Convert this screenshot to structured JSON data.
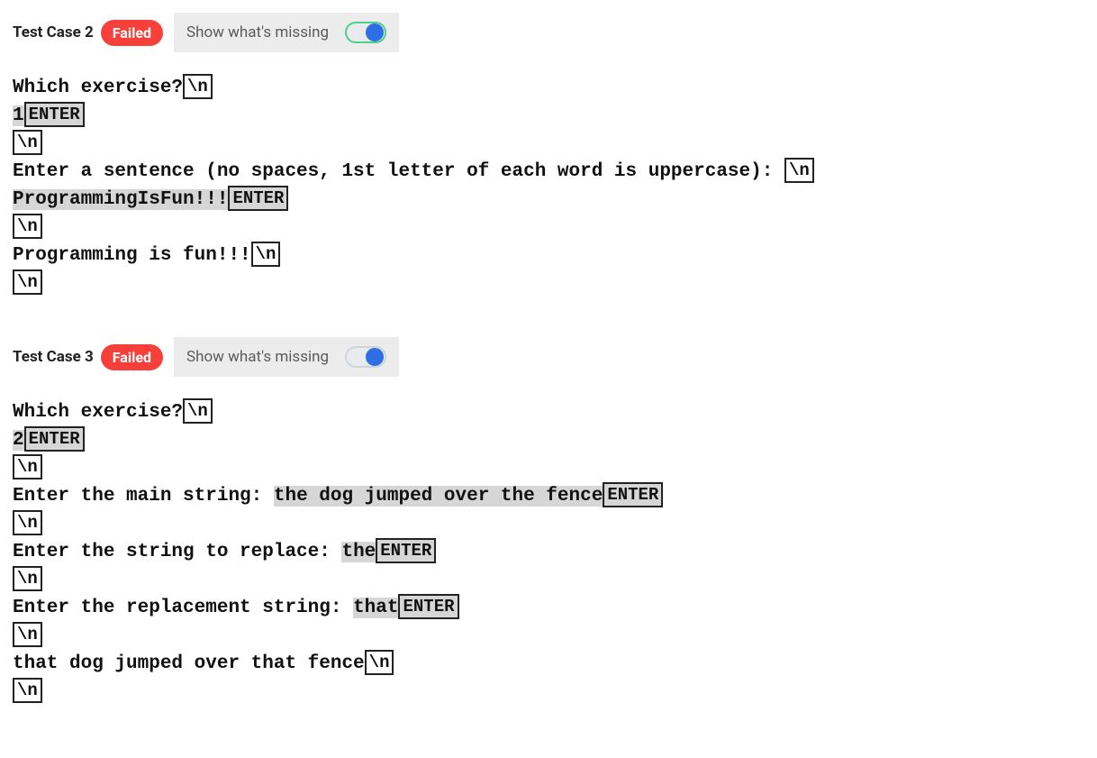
{
  "tokens": {
    "nl": "\\n",
    "enter": "ENTER"
  },
  "toggle": {
    "label": "Show what's missing"
  },
  "tests": [
    {
      "title": "Test Case 2",
      "status": "Failed",
      "toggle_variant": "green",
      "lines": [
        [
          {
            "t": "text",
            "v": "Which exercise?"
          },
          {
            "t": "nl"
          }
        ],
        [
          {
            "t": "text",
            "v": "1",
            "hl": true
          },
          {
            "t": "enter",
            "hl": true
          }
        ],
        [
          {
            "t": "nl"
          }
        ],
        [
          {
            "t": "text",
            "v": "Enter a sentence (no spaces, 1st letter of each word is uppercase): "
          },
          {
            "t": "nl"
          }
        ],
        [
          {
            "t": "text",
            "v": "ProgrammingIsFun!!!",
            "hl": true
          },
          {
            "t": "enter",
            "hl": true
          }
        ],
        [
          {
            "t": "nl"
          }
        ],
        [
          {
            "t": "text",
            "v": "Programming is fun!!!"
          },
          {
            "t": "nl"
          }
        ],
        [
          {
            "t": "nl"
          }
        ]
      ]
    },
    {
      "title": "Test Case 3",
      "status": "Failed",
      "toggle_variant": "plain",
      "lines": [
        [
          {
            "t": "text",
            "v": "Which exercise?"
          },
          {
            "t": "nl"
          }
        ],
        [
          {
            "t": "text",
            "v": "2",
            "hl": true
          },
          {
            "t": "enter",
            "hl": true
          }
        ],
        [
          {
            "t": "nl"
          }
        ],
        [
          {
            "t": "text",
            "v": "Enter the main string: "
          },
          {
            "t": "text",
            "v": "the dog jumped over the fence",
            "hl": true
          },
          {
            "t": "enter",
            "hl": true
          }
        ],
        [
          {
            "t": "nl"
          }
        ],
        [
          {
            "t": "text",
            "v": "Enter the string to replace: "
          },
          {
            "t": "text",
            "v": "the",
            "hl": true
          },
          {
            "t": "enter",
            "hl": true
          }
        ],
        [
          {
            "t": "nl"
          }
        ],
        [
          {
            "t": "text",
            "v": "Enter the replacement string: "
          },
          {
            "t": "text",
            "v": "that",
            "hl": true
          },
          {
            "t": "enter",
            "hl": true
          }
        ],
        [
          {
            "t": "nl"
          }
        ],
        [
          {
            "t": "text",
            "v": "that dog jumped over that fence"
          },
          {
            "t": "nl"
          }
        ],
        [
          {
            "t": "nl"
          }
        ]
      ]
    }
  ]
}
